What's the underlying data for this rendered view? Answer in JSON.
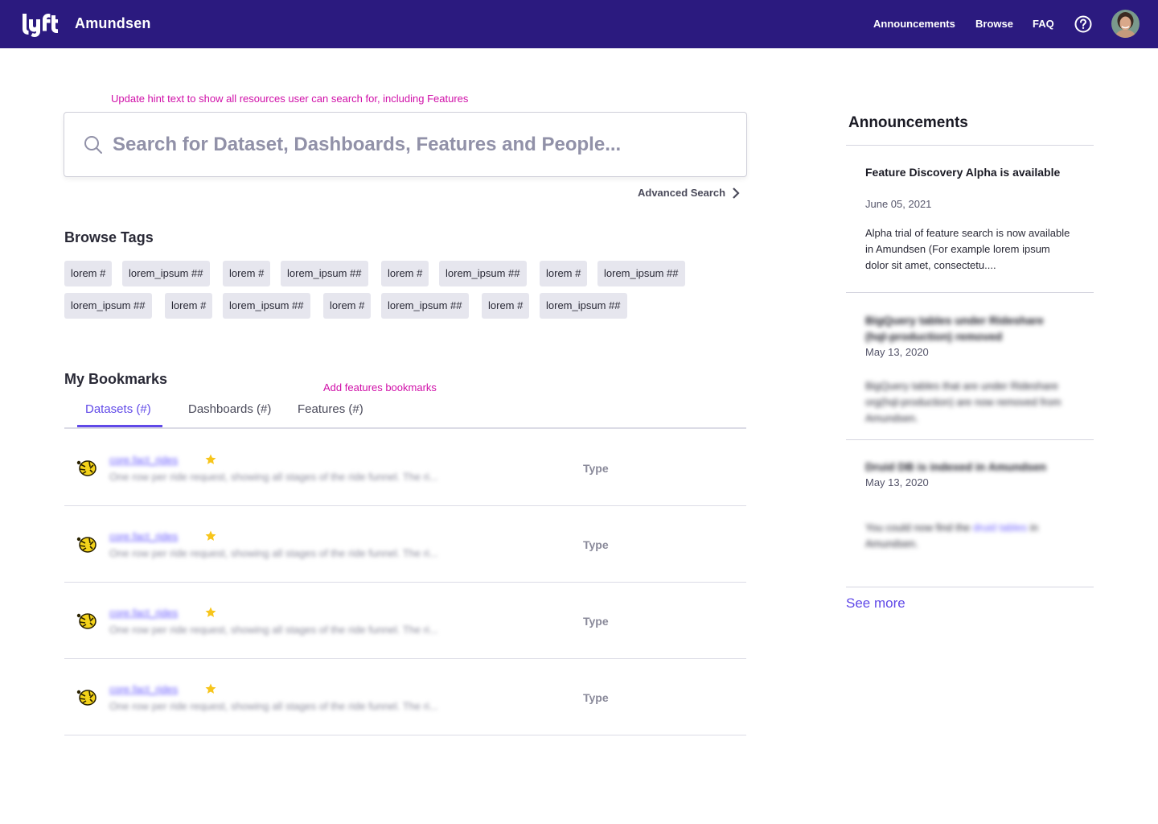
{
  "header": {
    "brand": "Amundsen",
    "logo_icon": "lyft-logo",
    "nav": [
      "Announcements",
      "Browse",
      "FAQ"
    ],
    "help_icon": "help-circle-icon",
    "bg_color": "#2b1a7f"
  },
  "annotations": {
    "search_hint": "Update hint text to show all resources user can search for, including Features",
    "bookmarks_hint": "Add features bookmarks"
  },
  "search": {
    "placeholder": "Search for Dataset, Dashboards, Features and People...",
    "advanced": "Advanced Search"
  },
  "browse_tags": {
    "title": "Browse Tags",
    "row1": [
      "lorem #",
      "lorem_ipsum ##",
      "lorem #",
      "lorem_ipsum ##",
      "lorem #",
      "lorem_ipsum ##",
      "lorem #",
      "lorem_ipsum ##"
    ],
    "row2": [
      "lorem_ipsum ##",
      "lorem #",
      "lorem_ipsum ##",
      "lorem #",
      "lorem_ipsum ##",
      "lorem #",
      "lorem_ipsum ##"
    ]
  },
  "bookmarks": {
    "title": "My Bookmarks",
    "tabs": [
      "Datasets (#)",
      "Dashboards (#)",
      "Features (#)"
    ],
    "active_tab": "Datasets (#)",
    "items": [
      {
        "title": "core.fact_rides",
        "description": "One row per ride request, showing all stages of the ride funnel. The ri...",
        "type": "Type"
      },
      {
        "title": "core.fact_rides",
        "description": "One row per ride request, showing all stages of the ride funnel. The ri...",
        "type": "Type"
      },
      {
        "title": "core.fact_rides",
        "description": "One row per ride request, showing all stages of the ride funnel. The ri...",
        "type": "Type"
      },
      {
        "title": "core.fact_rides",
        "description": "One row per ride request, showing all stages of the ride funnel. The ri...",
        "type": "Type"
      }
    ]
  },
  "announcements": {
    "title": "Announcements",
    "items": [
      {
        "title": "Feature Discovery Alpha is available",
        "date": "June 05, 2021",
        "body": "Alpha trial of feature search is now available in Amundsen (For example lorem ipsum dolor sit amet, consectetu...."
      },
      {
        "title": "BigQuery tables under Rideshare (hql-production) removed",
        "date": "May 13, 2020",
        "body": "BigQuery tables that are under Rideshare org(hql-production) are now removed from Amundsen."
      },
      {
        "title": "Druid DB is indexed in Amundsen",
        "date": "May 13, 2020",
        "body_prefix": "You could now find the",
        "body_link": "druid tables",
        "body_suffix": "in Amundsen."
      }
    ],
    "see_more": "See more"
  }
}
